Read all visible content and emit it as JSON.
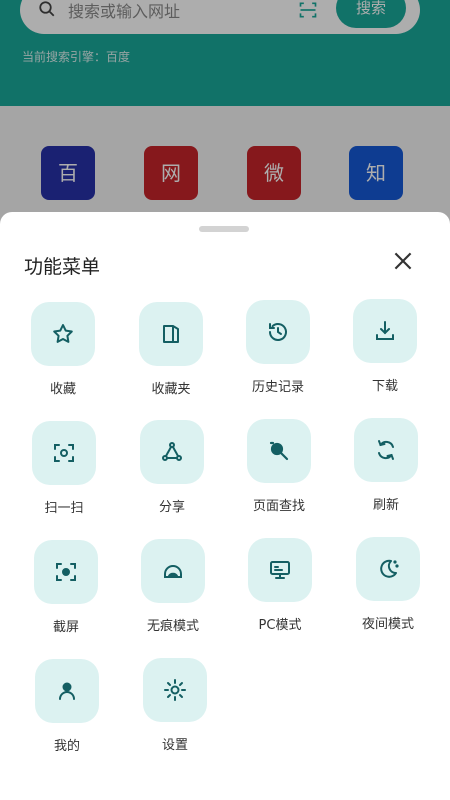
{
  "background": {
    "search_placeholder": "搜索或输入网址",
    "search_button": "搜索",
    "engine_line": "当前搜索引擎：百度",
    "quick_links": [
      {
        "glyph": "百",
        "color": "#2732a8"
      },
      {
        "glyph": "网",
        "color": "#c6242a"
      },
      {
        "glyph": "微",
        "color": "#c6242a"
      },
      {
        "glyph": "知",
        "color": "#1559d6"
      }
    ]
  },
  "sheet": {
    "title": "功能菜单",
    "close_icon": "close-icon",
    "items": [
      {
        "label": "收藏",
        "icon": "star-icon"
      },
      {
        "label": "收藏夹",
        "icon": "book-icon"
      },
      {
        "label": "历史记录",
        "icon": "history-icon"
      },
      {
        "label": "下载",
        "icon": "download-icon"
      },
      {
        "label": "扫一扫",
        "icon": "scan-icon"
      },
      {
        "label": "分享",
        "icon": "share-icon"
      },
      {
        "label": "页面查找",
        "icon": "find-icon"
      },
      {
        "label": "刷新",
        "icon": "refresh-icon"
      },
      {
        "label": "截屏",
        "icon": "screenshot-icon"
      },
      {
        "label": "无痕模式",
        "icon": "incognito-icon"
      },
      {
        "label": "PC模式",
        "icon": "pc-icon"
      },
      {
        "label": "夜间模式",
        "icon": "moon-icon"
      },
      {
        "label": "我的",
        "icon": "person-icon"
      },
      {
        "label": "设置",
        "icon": "settings-icon"
      }
    ]
  },
  "colors": {
    "accent": "#1aa89a",
    "icon_stroke": "#145f63",
    "tile_bg": "#dcf2f1"
  }
}
